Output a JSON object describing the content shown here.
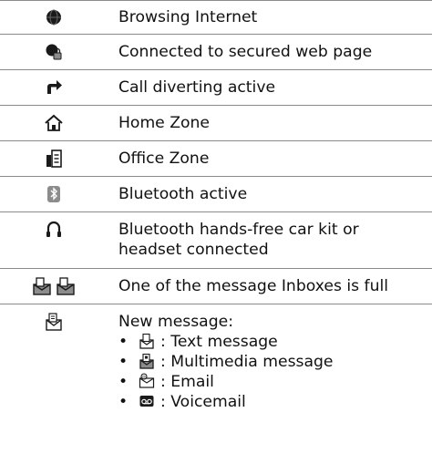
{
  "rows": [
    {
      "label": "Browsing Internet",
      "icon": "globe-icon"
    },
    {
      "label": "Connected to secured web page",
      "icon": "secure-globe-icon"
    },
    {
      "label": "Call diverting active",
      "icon": "call-divert-icon"
    },
    {
      "label": "Home Zone",
      "icon": "home-icon"
    },
    {
      "label": "Office Zone",
      "icon": "office-icon"
    },
    {
      "label": "Bluetooth active",
      "icon": "bluetooth-icon"
    },
    {
      "label_line1": "Bluetooth hands-free car kit or",
      "label_line2": "headset connected",
      "icon": "headset-icon"
    },
    {
      "label": "One of the message Inboxes is full",
      "icon": "inbox-full-icon"
    },
    {
      "label": "New message:",
      "icon": "new-message-icon",
      "sub_items": [
        {
          "label": ": Text message",
          "icon": "text-message-icon"
        },
        {
          "label": ": Multimedia message",
          "icon": "multimedia-message-icon"
        },
        {
          "label": ": Email",
          "icon": "email-icon"
        },
        {
          "label": ": Voicemail",
          "icon": "voicemail-icon"
        }
      ]
    }
  ],
  "bullet": "•",
  "colors": {
    "rule": "#8a8a8a",
    "text": "#111111",
    "icon_dark": "#1a1a1a",
    "icon_gray": "#8c8c8c"
  }
}
